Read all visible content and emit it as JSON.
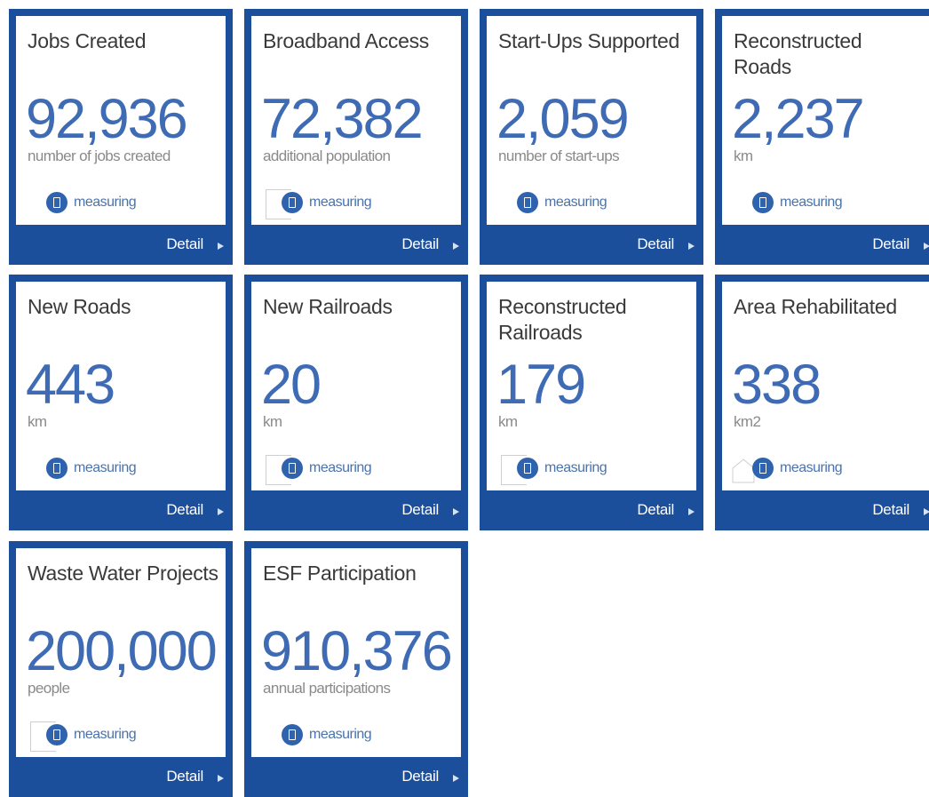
{
  "cards": [
    {
      "title": "Jobs Created",
      "value": "92,936",
      "unit": "number of jobs created",
      "status": "measuring",
      "detail": "Detail",
      "decor": "none"
    },
    {
      "title": "Broadband Access",
      "value": "72,382",
      "unit": "additional population",
      "status": "measuring",
      "detail": "Detail",
      "decor": "box"
    },
    {
      "title": "Start-Ups Supported",
      "value": "2,059",
      "unit": "number of start-ups",
      "status": "measuring",
      "detail": "Detail",
      "decor": "none"
    },
    {
      "title": "Reconstructed Roads",
      "value": "2,237",
      "unit": "km",
      "status": "measuring",
      "detail": "Detail",
      "decor": "none"
    },
    {
      "title": "New Roads",
      "value": "443",
      "unit": "km",
      "status": "measuring",
      "detail": "Detail",
      "decor": "none"
    },
    {
      "title": "New Railroads",
      "value": "20",
      "unit": "km",
      "status": "measuring",
      "detail": "Detail",
      "decor": "box"
    },
    {
      "title": "Reconstructed Railroads",
      "value": "179",
      "unit": "km",
      "status": "measuring",
      "detail": "Detail",
      "decor": "box"
    },
    {
      "title": "Area Rehabilitated",
      "value": "338",
      "unit": "km2",
      "status": "measuring",
      "detail": "Detail",
      "decor": "house"
    },
    {
      "title": "Waste Water Projects",
      "value": "200,000",
      "unit": "people",
      "status": "measuring",
      "detail": "Detail",
      "decor": "box"
    },
    {
      "title": "ESF Participation",
      "value": "910,376",
      "unit": "annual participations",
      "status": "measuring",
      "detail": "Detail",
      "decor": "none"
    }
  ],
  "colors": {
    "frame": "#1b4f9c",
    "value": "#3e6bb4",
    "status_dot": "#2f63ae"
  },
  "icons": {
    "status": "tablet-icon",
    "detail": "triangle-right-icon"
  }
}
